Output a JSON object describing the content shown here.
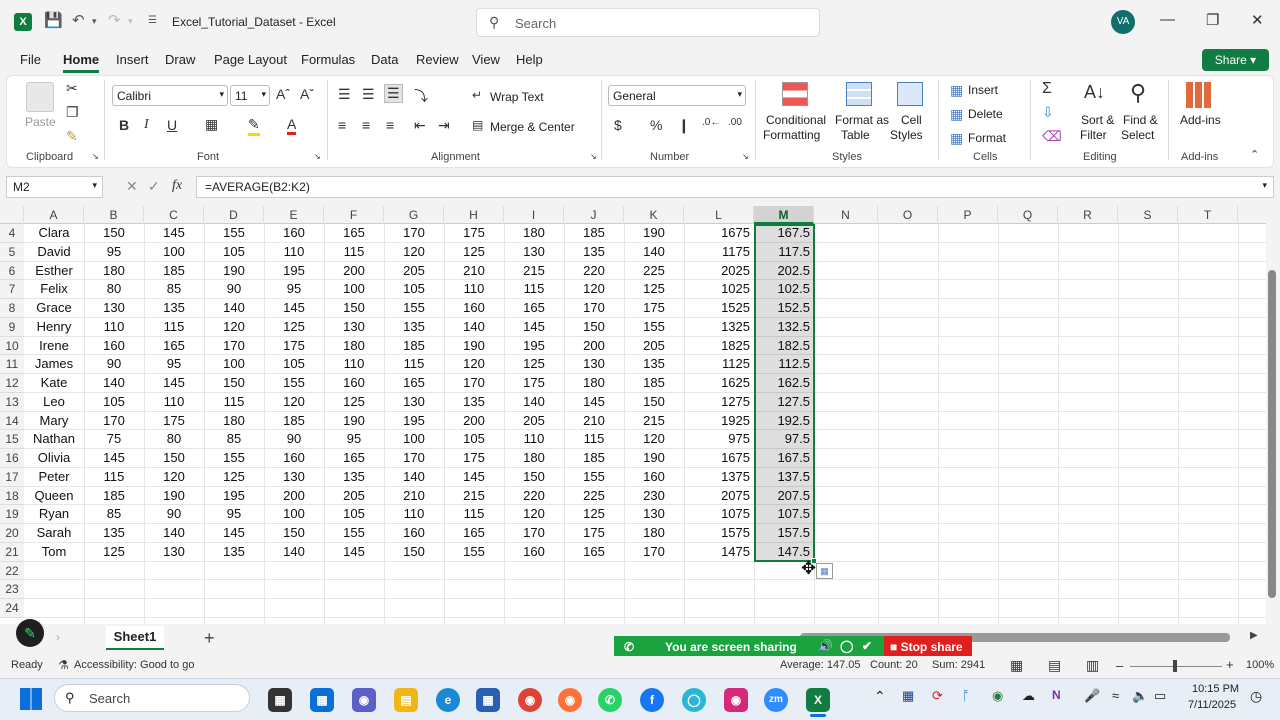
{
  "title_bar": {
    "doc_title": "Excel_Tutorial_Dataset  -  Excel",
    "search_placeholder": "Search",
    "avatar_initials": "VA"
  },
  "menu": [
    "File",
    "Home",
    "Insert",
    "Draw",
    "Page Layout",
    "Formulas",
    "Data",
    "Review",
    "View",
    "Help"
  ],
  "share_label": "Share",
  "ribbon": {
    "clipboard": {
      "paste": "Paste",
      "group": "Clipboard"
    },
    "font": {
      "name": "Calibri",
      "size": "11",
      "group": "Font"
    },
    "alignment": {
      "wrap": "Wrap Text",
      "merge": "Merge & Center",
      "group": "Alignment"
    },
    "number": {
      "format": "General",
      "group": "Number"
    },
    "styles": {
      "cond1": "Conditional",
      "cond2": "Formatting",
      "fmt1": "Format as",
      "fmt2": "Table",
      "cell1": "Cell",
      "cell2": "Styles",
      "group": "Styles"
    },
    "cells": {
      "insert": "Insert",
      "delete": "Delete",
      "format": "Format",
      "group": "Cells"
    },
    "editing": {
      "sort1": "Sort &",
      "sort2": "Filter",
      "find1": "Find &",
      "find2": "Select",
      "group": "Editing"
    },
    "addins": {
      "label": "Add-ins",
      "group": "Add-ins"
    }
  },
  "formula_bar": {
    "name_box": "M2",
    "formula": "=AVERAGE(B2:K2)"
  },
  "columns": [
    "A",
    "B",
    "C",
    "D",
    "E",
    "F",
    "G",
    "H",
    "I",
    "J",
    "K",
    "L",
    "M",
    "N",
    "O",
    "P",
    "Q",
    "R",
    "S",
    "T"
  ],
  "rows": [
    {
      "n": "4",
      "name": "Clara",
      "v": [
        "150",
        "145",
        "155",
        "160",
        "165",
        "170",
        "175",
        "180",
        "185",
        "190"
      ],
      "l": "1675",
      "m": "167.5"
    },
    {
      "n": "5",
      "name": "David",
      "v": [
        "95",
        "100",
        "105",
        "110",
        "115",
        "120",
        "125",
        "130",
        "135",
        "140"
      ],
      "l": "1175",
      "m": "117.5"
    },
    {
      "n": "6",
      "name": "Esther",
      "v": [
        "180",
        "185",
        "190",
        "195",
        "200",
        "205",
        "210",
        "215",
        "220",
        "225"
      ],
      "l": "2025",
      "m": "202.5"
    },
    {
      "n": "7",
      "name": "Felix",
      "v": [
        "80",
        "85",
        "90",
        "95",
        "100",
        "105",
        "110",
        "115",
        "120",
        "125"
      ],
      "l": "1025",
      "m": "102.5"
    },
    {
      "n": "8",
      "name": "Grace",
      "v": [
        "130",
        "135",
        "140",
        "145",
        "150",
        "155",
        "160",
        "165",
        "170",
        "175"
      ],
      "l": "1525",
      "m": "152.5"
    },
    {
      "n": "9",
      "name": "Henry",
      "v": [
        "110",
        "115",
        "120",
        "125",
        "130",
        "135",
        "140",
        "145",
        "150",
        "155"
      ],
      "l": "1325",
      "m": "132.5"
    },
    {
      "n": "10",
      "name": "Irene",
      "v": [
        "160",
        "165",
        "170",
        "175",
        "180",
        "185",
        "190",
        "195",
        "200",
        "205"
      ],
      "l": "1825",
      "m": "182.5"
    },
    {
      "n": "11",
      "name": "James",
      "v": [
        "90",
        "95",
        "100",
        "105",
        "110",
        "115",
        "120",
        "125",
        "130",
        "135"
      ],
      "l": "1125",
      "m": "112.5"
    },
    {
      "n": "12",
      "name": "Kate",
      "v": [
        "140",
        "145",
        "150",
        "155",
        "160",
        "165",
        "170",
        "175",
        "180",
        "185"
      ],
      "l": "1625",
      "m": "162.5"
    },
    {
      "n": "13",
      "name": "Leo",
      "v": [
        "105",
        "110",
        "115",
        "120",
        "125",
        "130",
        "135",
        "140",
        "145",
        "150"
      ],
      "l": "1275",
      "m": "127.5"
    },
    {
      "n": "14",
      "name": "Mary",
      "v": [
        "170",
        "175",
        "180",
        "185",
        "190",
        "195",
        "200",
        "205",
        "210",
        "215"
      ],
      "l": "1925",
      "m": "192.5"
    },
    {
      "n": "15",
      "name": "Nathan",
      "v": [
        "75",
        "80",
        "85",
        "90",
        "95",
        "100",
        "105",
        "110",
        "115",
        "120"
      ],
      "l": "975",
      "m": "97.5"
    },
    {
      "n": "16",
      "name": "Olivia",
      "v": [
        "145",
        "150",
        "155",
        "160",
        "165",
        "170",
        "175",
        "180",
        "185",
        "190"
      ],
      "l": "1675",
      "m": "167.5"
    },
    {
      "n": "17",
      "name": "Peter",
      "v": [
        "115",
        "120",
        "125",
        "130",
        "135",
        "140",
        "145",
        "150",
        "155",
        "160"
      ],
      "l": "1375",
      "m": "137.5"
    },
    {
      "n": "18",
      "name": "Queen",
      "v": [
        "185",
        "190",
        "195",
        "200",
        "205",
        "210",
        "215",
        "220",
        "225",
        "230"
      ],
      "l": "2075",
      "m": "207.5"
    },
    {
      "n": "19",
      "name": "Ryan",
      "v": [
        "85",
        "90",
        "95",
        "100",
        "105",
        "110",
        "115",
        "120",
        "125",
        "130"
      ],
      "l": "1075",
      "m": "107.5"
    },
    {
      "n": "20",
      "name": "Sarah",
      "v": [
        "135",
        "140",
        "145",
        "150",
        "155",
        "160",
        "165",
        "170",
        "175",
        "180"
      ],
      "l": "1575",
      "m": "157.5"
    },
    {
      "n": "21",
      "name": "Tom",
      "v": [
        "125",
        "130",
        "135",
        "140",
        "145",
        "150",
        "155",
        "160",
        "165",
        "170"
      ],
      "l": "1475",
      "m": "147.5"
    },
    {
      "n": "22",
      "name": "",
      "v": [],
      "l": "",
      "m": ""
    },
    {
      "n": "23",
      "name": "",
      "v": [],
      "l": "",
      "m": ""
    },
    {
      "n": "24",
      "name": "",
      "v": [],
      "l": "",
      "m": ""
    }
  ],
  "sheet_tab": "Sheet1",
  "screen_share": {
    "notice": "You are screen sharing",
    "stop": "Stop share"
  },
  "status": {
    "ready": "Ready",
    "accessibility": "Accessibility: Good to go",
    "average": "Average: 147.05",
    "count": "Count: 20",
    "sum": "Sum: 2941",
    "zoom": "100%"
  },
  "taskbar": {
    "search": "Search",
    "time": "10:15 PM",
    "date": "7/11/2025"
  }
}
